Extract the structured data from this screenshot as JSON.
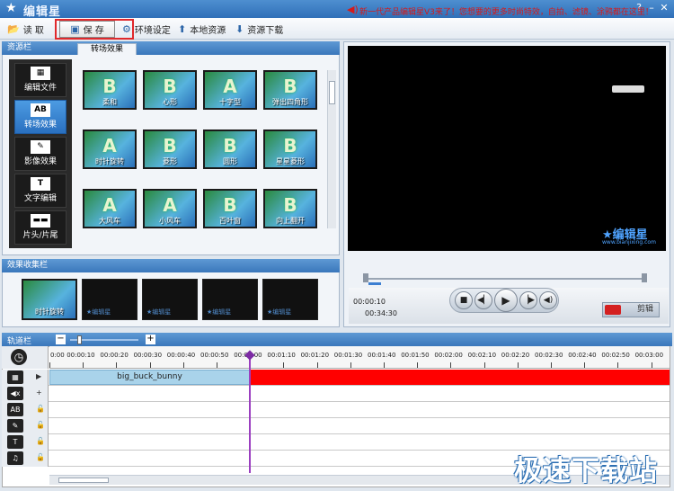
{
  "app": {
    "title": "编辑星"
  },
  "toolbar": {
    "read": "读  取",
    "save": "保  存",
    "env": "环境设定",
    "local": "本地资源",
    "download": "资源下载",
    "promo": "新一代产品编辑星V3来了！您想要的更多时尚特效，自拍、滤镜、涂鸦都在这里！"
  },
  "resource_panel": {
    "title": "资源栏",
    "tab": "转场效果",
    "side": [
      {
        "label": "编辑文件",
        "icon": "film-icon",
        "glyph": "▦"
      },
      {
        "label": "转场效果",
        "icon": "ab-transition-icon",
        "glyph": "AB"
      },
      {
        "label": "影像效果",
        "icon": "image-effect-icon",
        "glyph": "✎"
      },
      {
        "label": "文字编辑",
        "icon": "text-icon",
        "glyph": "T"
      },
      {
        "label": "片头/片尾",
        "icon": "intro-outro-icon",
        "glyph": "▬▬"
      }
    ],
    "effects": [
      {
        "name": "柔和",
        "letter": "B"
      },
      {
        "name": "心形",
        "letter": "B"
      },
      {
        "name": "十字型",
        "letter": "A"
      },
      {
        "name": "弹出四角形",
        "letter": "B"
      },
      {
        "name": "时针旋转",
        "letter": "A"
      },
      {
        "name": "菱形",
        "letter": "B"
      },
      {
        "name": "圆形",
        "letter": "B"
      },
      {
        "name": "星星菱形",
        "letter": "B"
      },
      {
        "name": "大风车",
        "letter": "A"
      },
      {
        "name": "小风车",
        "letter": "A"
      },
      {
        "name": "百叶窗",
        "letter": "B"
      },
      {
        "name": "向上翻开",
        "letter": "B"
      }
    ]
  },
  "collect_panel": {
    "title": "效果收集栏",
    "items": [
      "时针旋转",
      "",
      "",
      "",
      ""
    ],
    "watermark": "★编辑星"
  },
  "preview": {
    "watermark_logo": "★编辑星",
    "watermark_url": "www.bianjixing.com",
    "time_current": "00:00:10",
    "time_total": "00:34:30",
    "clip_label": "剪辑"
  },
  "track": {
    "title": "轨道栏",
    "ticks": [
      "0:00",
      "00:00:10",
      "00:00:20",
      "00:00:30",
      "00:00:40",
      "00:00:50",
      "00:01:00",
      "00:01:10",
      "00:01:20",
      "00:01:30",
      "00:01:40",
      "00:01:50",
      "00:02:00",
      "00:02:10",
      "00:02:20",
      "00:02:30",
      "00:02:40",
      "00:02:50",
      "00:03:00"
    ],
    "clip_name": "big_buck_bunny"
  },
  "footer_watermark": "极速下载站",
  "colors": {
    "accent": "#3a77bb",
    "highlight": "#e0292c",
    "timeline_red": "#ff0000",
    "clip_blue": "#a9d3ea"
  }
}
